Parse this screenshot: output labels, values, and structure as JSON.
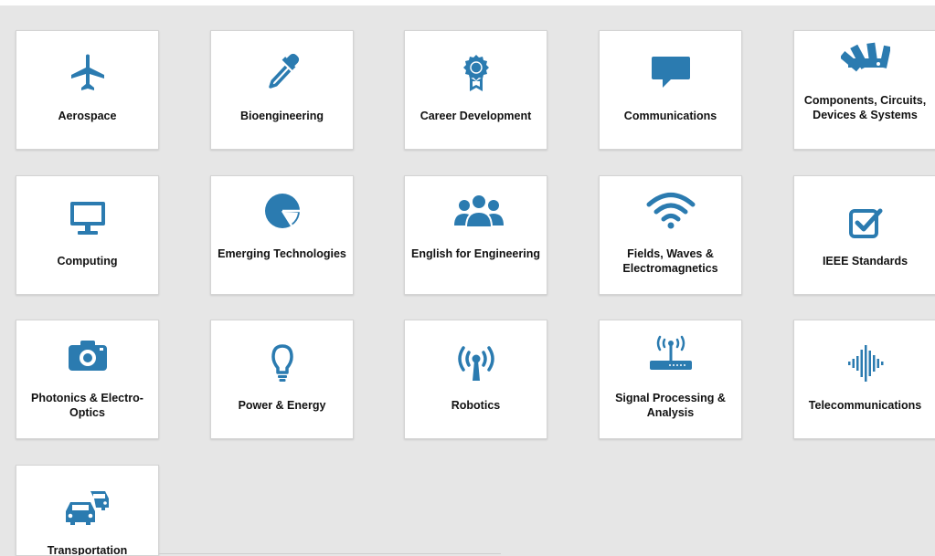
{
  "accent_color": "#2b7bb0",
  "background_color": "#e6e6e6",
  "topics": [
    {
      "label": "Aerospace",
      "icon": "airplane-icon"
    },
    {
      "label": "Bioengineering",
      "icon": "dropper-icon"
    },
    {
      "label": "Career Development",
      "icon": "award-ribbon-icon"
    },
    {
      "label": "Communications",
      "icon": "speech-bubble-icon"
    },
    {
      "label": "Components, Circuits, Devices & Systems",
      "icon": "swatch-fan-icon"
    },
    {
      "label": "Computing",
      "icon": "monitor-icon"
    },
    {
      "label": "Emerging Technologies",
      "icon": "pie-chart-icon"
    },
    {
      "label": "English for Engineering",
      "icon": "people-group-icon"
    },
    {
      "label": "Fields, Waves & Electromagnetics",
      "icon": "wifi-signal-icon"
    },
    {
      "label": "IEEE Standards",
      "icon": "checkbox-icon"
    },
    {
      "label": "Photonics & Electro-Optics",
      "icon": "camera-icon"
    },
    {
      "label": "Power & Energy",
      "icon": "lightbulb-icon"
    },
    {
      "label": "Robotics",
      "icon": "antenna-icon"
    },
    {
      "label": "Signal Processing & Analysis",
      "icon": "router-icon"
    },
    {
      "label": "Telecommunications",
      "icon": "waveform-icon"
    },
    {
      "label": "Transportation",
      "icon": "cars-icon"
    }
  ]
}
